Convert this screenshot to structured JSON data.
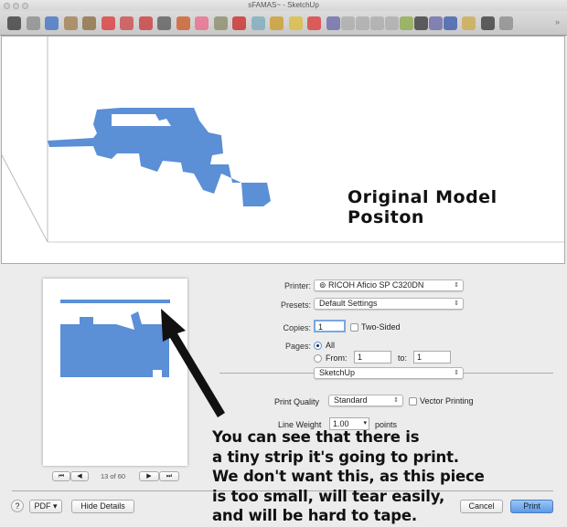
{
  "window": {
    "title": "sFAMAS~ - SketchUp"
  },
  "toolbar": {
    "tools": [
      "select",
      "make-component",
      "orbit",
      "rectangle",
      "circle",
      "move",
      "rotate",
      "arc",
      "follow-me",
      "push-pull",
      "eraser",
      "paint-bucket",
      "tape-measure",
      "pencil",
      "section-plane",
      "components",
      "pan",
      "zoom-extents",
      "iso-view",
      "top-view",
      "front-view",
      "right-view",
      "back-view",
      "left-view",
      "shaded",
      "monochrome",
      "x-ray",
      "zoom",
      "walk"
    ],
    "overflow": "»"
  },
  "viewport": {
    "annotation": "Original Model Positon",
    "model_color": "#5b8fd6"
  },
  "print": {
    "printer_label": "Printer:",
    "printer": "RICOH Aficio SP C320DN",
    "presets_label": "Presets:",
    "presets": "Default Settings",
    "copies_label": "Copies:",
    "copies": "1",
    "two_sided": "Two-Sided",
    "pages_label": "Pages:",
    "all": "All",
    "from_label": "From:",
    "from": "1",
    "to_label": "to:",
    "to": "1",
    "section": "SketchUp",
    "quality_label": "Print Quality",
    "quality": "Standard",
    "vector": "Vector Printing",
    "lineweight_label": "Line Weight",
    "lineweight": "1.00",
    "points": "points",
    "page_indicator": "13 of 60",
    "help": "?",
    "pdf": "PDF",
    "hide_details": "Hide Details",
    "cancel": "Cancel",
    "print": "Print"
  },
  "annotation": {
    "lines": [
      "You can see that there is",
      "a tiny strip it's going to print.",
      "We don't want this, as this piece",
      "is too small, will tear easily,",
      "and will be hard to tape."
    ]
  }
}
